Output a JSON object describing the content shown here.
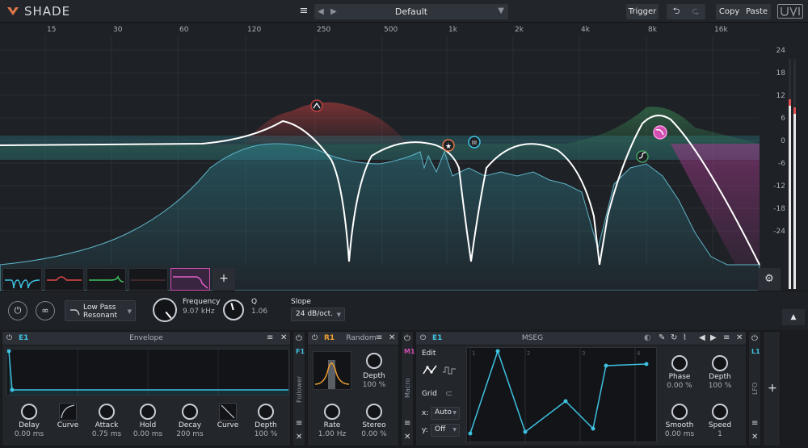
{
  "header": {
    "app_title": "SHADE",
    "preset_name": "Default",
    "trigger_label": "Trigger",
    "copy_label": "Copy",
    "paste_label": "Paste"
  },
  "eq": {
    "freq_ticks": [
      "15",
      "30",
      "60",
      "120",
      "250",
      "500",
      "1k",
      "2k",
      "4k",
      "8k",
      "16k"
    ],
    "db_ticks": [
      "24",
      "18",
      "12",
      "6",
      "0",
      "-6",
      "-12",
      "-18",
      "-24"
    ],
    "add_band_label": "+"
  },
  "band": {
    "filter_type_line1": "Low Pass",
    "filter_type_line2": "Resonant",
    "frequency_label": "Frequency",
    "frequency_value": "9.07 kHz",
    "q_label": "Q",
    "q_value": "1.06",
    "slope_label": "Slope",
    "slope_value": "24 dB/oct."
  },
  "envelope": {
    "tag": "E1",
    "title": "Envelope",
    "side_tag": "F1",
    "side_label": "Follower",
    "controls": [
      {
        "label": "Delay",
        "value": "0.00 ms"
      },
      {
        "label": "Curve",
        "value": ""
      },
      {
        "label": "Attack",
        "value": "0.75 ms"
      },
      {
        "label": "Hold",
        "value": "0.00 ms"
      },
      {
        "label": "Decay",
        "value": "200 ms"
      },
      {
        "label": "Curve",
        "value": ""
      },
      {
        "label": "Depth",
        "value": "100 %"
      }
    ]
  },
  "random": {
    "tag": "R1",
    "title": "Random",
    "side_tag": "M1",
    "side_label": "Macro",
    "depth_label": "Depth",
    "depth_value": "100 %",
    "rate_label": "Rate",
    "rate_value": "1.00 Hz",
    "stereo_label": "Stereo",
    "stereo_value": "0.00 %"
  },
  "mseg": {
    "tag": "E1",
    "title": "MSEG",
    "edit_label": "Edit",
    "grid_label": "Grid",
    "x_label": "x:",
    "x_value": "Auto",
    "y_label": "y:",
    "y_value": "Off",
    "grid_numbers": [
      "1",
      "2",
      "3",
      "4"
    ],
    "phase_label": "Phase",
    "phase_value": "0.00 %",
    "depth_label": "Depth",
    "depth_value": "100 %",
    "smooth_label": "Smooth",
    "smooth_value": "0.00 ms",
    "speed_label": "Speed",
    "speed_value": "1",
    "side_tag": "L1",
    "side_label": "LFO",
    "add_label": "+"
  },
  "colors": {
    "accent_cyan": "#3fc1e0",
    "accent_pink": "#d14fb0",
    "accent_orange": "#f0a030",
    "band_red": "#c04040",
    "band_green": "#40a060"
  }
}
